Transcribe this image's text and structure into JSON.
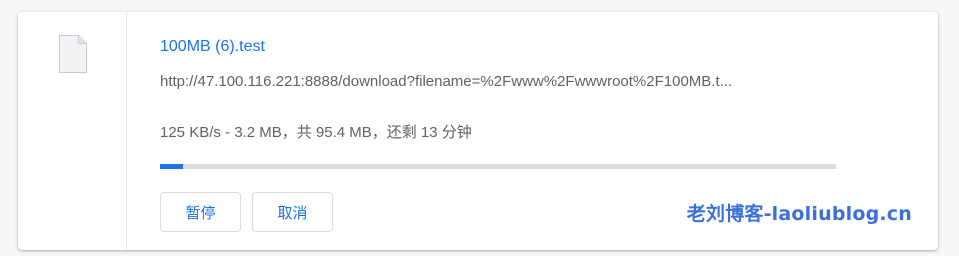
{
  "download": {
    "file_icon": "blank-document-icon",
    "file_name": "100MB (6).test",
    "url": "http://47.100.116.221:8888/download?filename=%2Fwww%2Fwwwroot%2F100MB.t...",
    "status": "125 KB/s - 3.2 MB，共 95.4 MB，还剩 13 分钟",
    "progress_fraction": 0.034,
    "pause_label": "暂停",
    "cancel_label": "取消"
  },
  "watermark": "老刘博客-laoliublog.cn",
  "colors": {
    "accent": "#1a73e8",
    "track": "#dadce0",
    "secondary_text": "#5f6368",
    "watermark": "#3d6fdc"
  }
}
